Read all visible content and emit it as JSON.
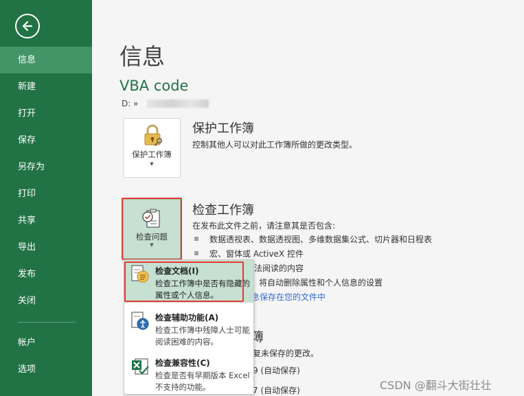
{
  "sidebar": {
    "back_icon": "back-arrow-icon",
    "items": [
      {
        "label": "信息",
        "active": true
      },
      {
        "label": "新建",
        "active": false
      },
      {
        "label": "打开",
        "active": false
      },
      {
        "label": "保存",
        "active": false
      },
      {
        "label": "另存为",
        "active": false
      },
      {
        "label": "打印",
        "active": false
      },
      {
        "label": "共享",
        "active": false
      },
      {
        "label": "导出",
        "active": false
      },
      {
        "label": "发布",
        "active": false
      },
      {
        "label": "关闭",
        "active": false
      }
    ],
    "bottom_items": [
      {
        "label": "帐户"
      },
      {
        "label": "选项"
      }
    ],
    "bg_color": "#217346",
    "active_color": "#439467"
  },
  "main": {
    "title": "信息",
    "doc_name": "VBA code",
    "doc_path": "D: »",
    "protect": {
      "tile_label": "保护工作簿",
      "title": "保护工作簿",
      "desc": "控制其他人可以对此工作簿所做的更改类型。"
    },
    "inspect": {
      "tile_label": "检查问题",
      "title": "检查工作簿",
      "desc": "在发布此文件之前，请注意其是否包含:",
      "bullets": [
        "数据透视表、数据透视图、多维数据集公式、切片器和日程表",
        "宏、窗体或 ActiveX 控件"
      ],
      "partial_1": "法阅读的内容",
      "partial_2": "将自动删除属性和个人信息的设置",
      "partial_link": "息保存在您的文件中"
    },
    "versions": {
      "partial_title": "簿",
      "partial_desc": "复未保存的更改。",
      "entry_1": "9 (自动保存)",
      "entry_2": "7 (自动保存)"
    }
  },
  "menu": {
    "items": [
      {
        "title": "检查文档(I)",
        "desc": "检查工作簿中是否有隐藏的属性或个人信息。",
        "icon": "inspect-document-icon",
        "highlighted": true
      },
      {
        "title": "检查辅助功能(A)",
        "desc": "检查工作簿中残障人士可能阅读困难的内容。",
        "icon": "accessibility-check-icon",
        "highlighted": false
      },
      {
        "title": "检查兼容性(C)",
        "desc": "检查是否有早期版本 Excel 不支持的功能。",
        "icon": "compatibility-check-icon",
        "highlighted": false
      }
    ]
  },
  "watermark": "CSDN @翻斗大街壮壮",
  "colors": {
    "accent_green": "#217346",
    "highlight": "#c6e0d2",
    "annotation_red": "#e53935",
    "link": "#2e6ad1"
  }
}
